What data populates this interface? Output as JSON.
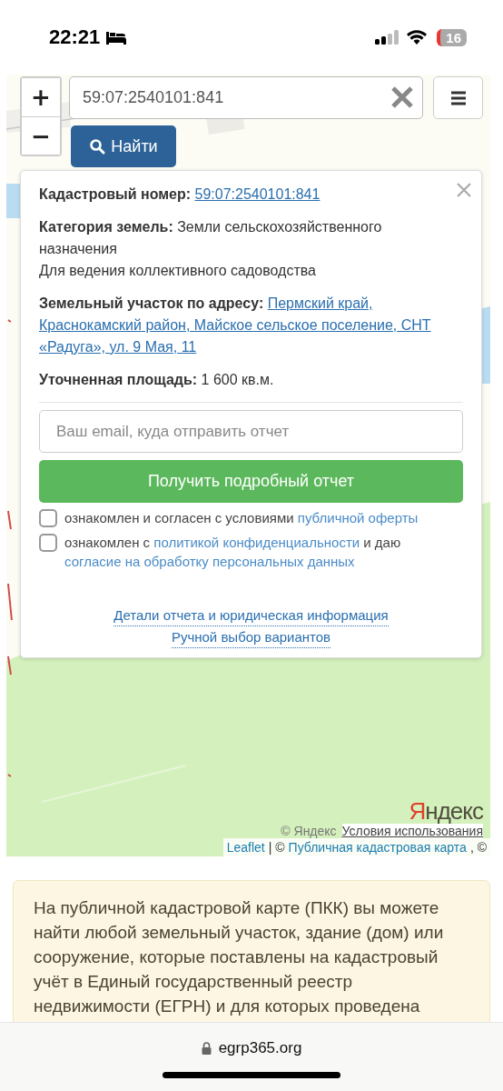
{
  "status_bar": {
    "time": "22:21",
    "battery": "16"
  },
  "map": {
    "zoom_in": "+",
    "zoom_out": "−",
    "search": {
      "value": "59:07:2540101:841"
    },
    "find_button": "Найти",
    "popup": {
      "cadastral_label": "Кадастровый номер:",
      "cadastral_number": "59:07:2540101:841",
      "category_label": "Категория земель:",
      "category_value": "Земли сельскохозяйственного назначения",
      "use": "Для ведения коллективного садоводства",
      "address_label": "Земельный участок по адресу:",
      "address_lines": [
        "Пермский край,",
        "Краснокамский район, Майское сельское поселение, СНТ «Радуга», ул. 9 Мая, 11"
      ],
      "area_label": "Уточненная площадь:",
      "area": "1 600 кв.м.",
      "email": {
        "placeholder": "Ваш email, куда отправить отчет"
      },
      "report_button": "Получить подробный отчет",
      "agreements": [
        {
          "checked": false,
          "parts": [
            {
              "text": "ознакомлен и согласен с условиями ",
              "link": false
            },
            {
              "text": "публичной оферты",
              "link": true
            }
          ]
        },
        {
          "checked": false,
          "parts": [
            {
              "text": "ознакомлен с ",
              "link": false
            },
            {
              "text": "политикой конфиденциальности",
              "link": true
            },
            {
              "text": " и даю ",
              "link": false
            },
            {
              "text": "согласие на обработку персональных данных",
              "link": true
            }
          ]
        }
      ],
      "links": [
        "Детали отчета и юридическая информация",
        "Ручной выбор вариантов"
      ]
    },
    "attribution": {
      "yandex_logo": "Яндекс",
      "yandex_copyright": "© Яндекс",
      "terms": "Условия использования",
      "leaflet": "Leaflet",
      "separator": "| ©",
      "pkk": "Публичная кадастровая карта",
      "tail": ", ©"
    }
  },
  "info": "На публичной кадастровой карте (ПКК) вы можете найти любой земельный участок, здание (дом) или сооружение, которые поставлены на кадастровый учёт в Единый государственный реестр недвижимости (ЕГРН) и для которых проведена",
  "browser": {
    "url": "egrp365.org"
  }
}
